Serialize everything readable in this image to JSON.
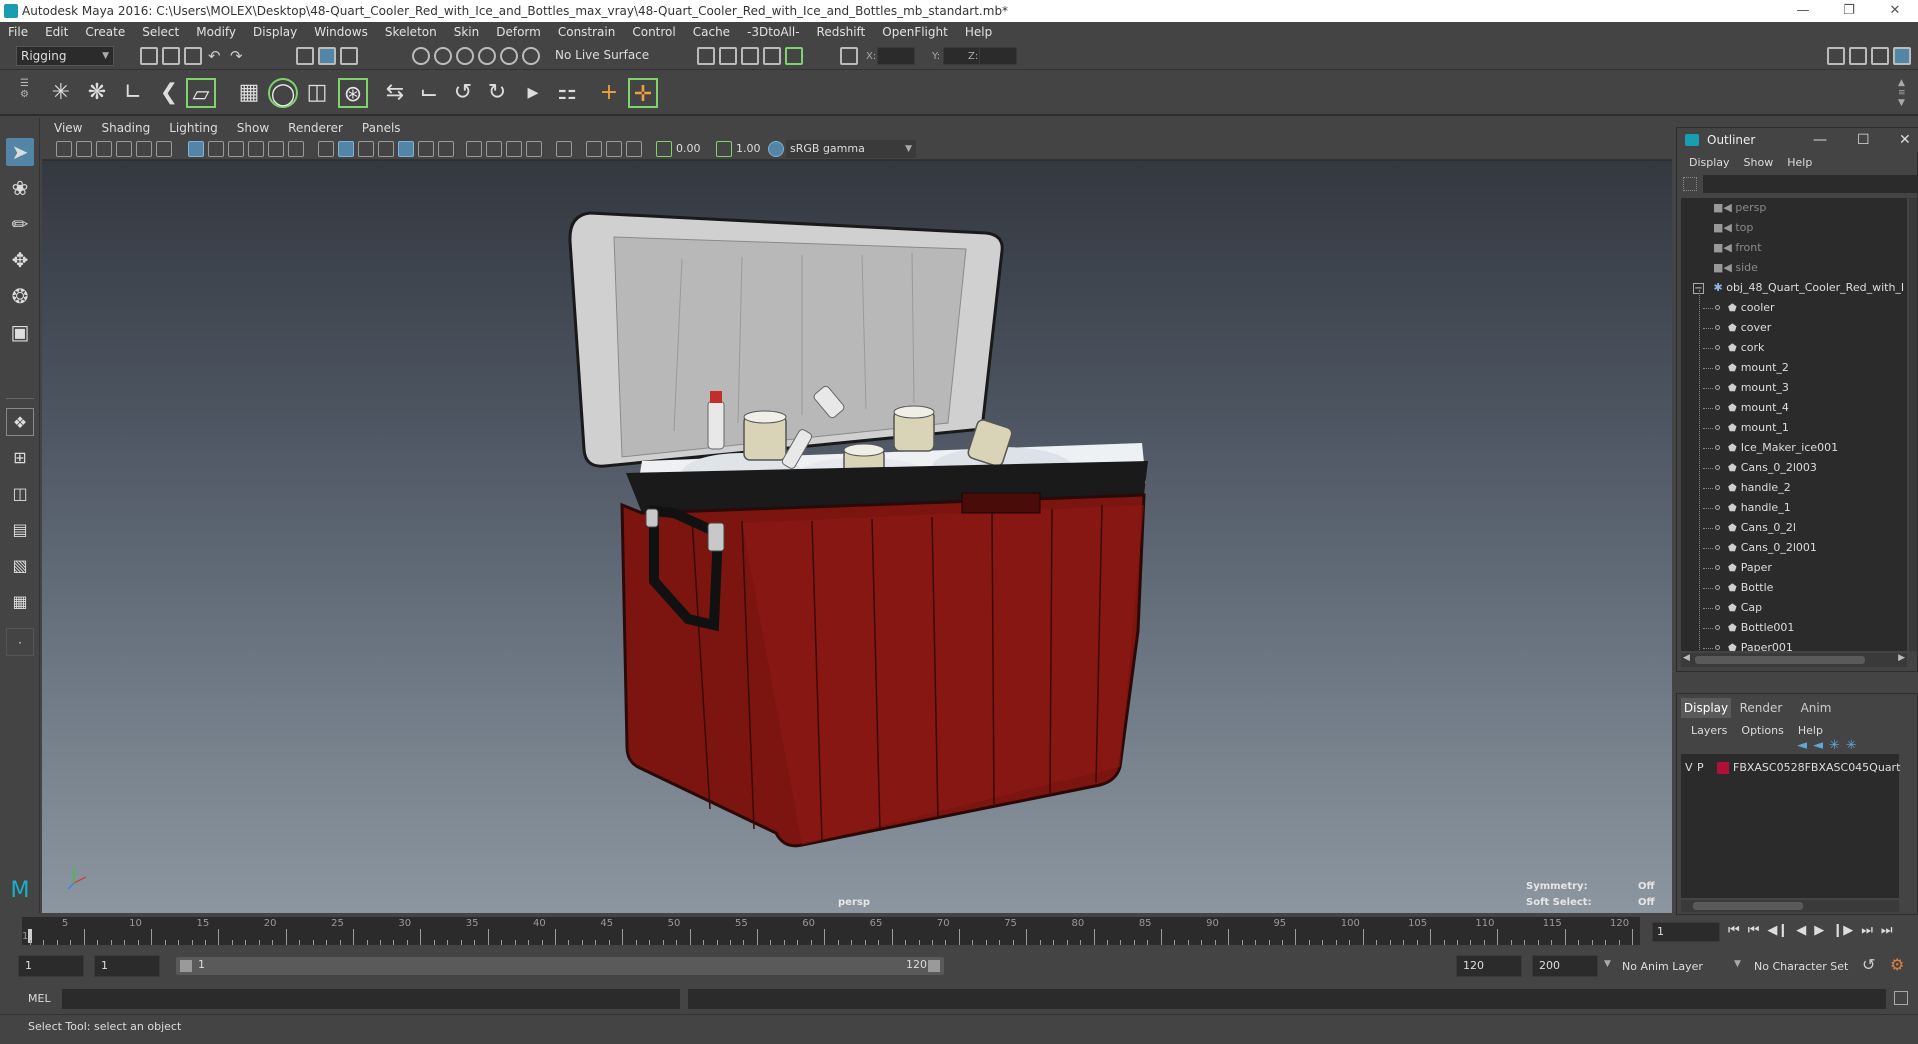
{
  "window": {
    "title": "Autodesk Maya 2016: C:\\Users\\MOLEX\\Desktop\\48-Quart_Cooler_Red_with_Ice_and_Bottles_max_vray\\48-Quart_Cooler_Red_with_Ice_and_Bottles_mb_standart.mb*"
  },
  "menubar": [
    "File",
    "Edit",
    "Create",
    "Select",
    "Modify",
    "Display",
    "Windows",
    "Skeleton",
    "Skin",
    "Deform",
    "Constrain",
    "Control",
    "Cache",
    "-3DtoAll-",
    "Redshift",
    "OpenFlight",
    "Help"
  ],
  "statusline": {
    "mode": "Rigging",
    "live_surface": "No Live Surface",
    "x_label": "X:",
    "y_label": "Y:",
    "z_label": "Z:"
  },
  "viewport": {
    "menu": [
      "View",
      "Shading",
      "Lighting",
      "Show",
      "Renderer",
      "Panels"
    ],
    "exposure": "0.00",
    "gamma": "1.00",
    "color_space": "sRGB gamma",
    "camera_label": "persp",
    "symmetry_label": "Symmetry:",
    "symmetry_value": "Off",
    "soft_select_label": "Soft Select:",
    "soft_select_value": "Off",
    "bg_top": "#343840",
    "bg_bottom": "#8c96a0"
  },
  "outliner": {
    "title": "Outliner",
    "menu": [
      "Display",
      "Show",
      "Help"
    ],
    "cameras": [
      "persp",
      "top",
      "front",
      "side"
    ],
    "group": "obj_48_Quart_Cooler_Red_with_I",
    "children": [
      "cooler",
      "cover",
      "cork",
      "mount_2",
      "mount_3",
      "mount_4",
      "mount_1",
      "Ice_Maker_ice001",
      "Cans_0_2l003",
      "handle_2",
      "handle_1",
      "Cans_0_2l",
      "Cans_0_2l001",
      "Paper",
      "Bottle",
      "Cap",
      "Bottle001",
      "Paper001"
    ]
  },
  "layer_editor": {
    "tabs": [
      "Display",
      "Render",
      "Anim"
    ],
    "menu": [
      "Layers",
      "Options",
      "Help"
    ],
    "layer": {
      "v": "V",
      "p": "P",
      "color": "#b0103a",
      "name": "FBXASC0528FBXASC045Quart"
    }
  },
  "timeline": {
    "ticks": [
      "5",
      "10",
      "15",
      "20",
      "25",
      "30",
      "35",
      "40",
      "45",
      "50",
      "55",
      "60",
      "65",
      "70",
      "75",
      "80",
      "85",
      "90",
      "95",
      "100",
      "105",
      "110",
      "115",
      "120"
    ],
    "start_marker": "1",
    "current_frame": "1"
  },
  "range": {
    "start": "1",
    "anim_start": "1",
    "inner_start": "1",
    "inner_end": "120",
    "end": "120",
    "anim_end": "200",
    "anim_layer": "No Anim Layer",
    "char_set": "No Character Set"
  },
  "cmdline": {
    "label": "MEL"
  },
  "helpline": {
    "text": "Select Tool: select an object"
  },
  "accent": "#5285a6",
  "shelf_highlight": "#7fd36b"
}
